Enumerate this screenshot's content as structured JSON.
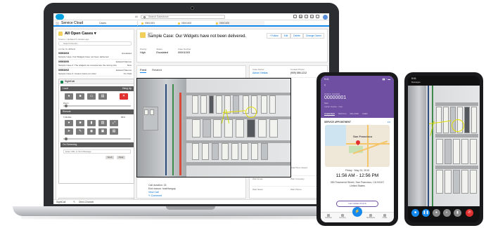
{
  "header": {
    "search_scope": "All",
    "search_placeholder": "Search Salesforce"
  },
  "app_nav": {
    "app_name": "Service Cloud",
    "object_select": "Cases",
    "tabs": [
      {
        "label": "00001001"
      },
      {
        "label": "00001002"
      },
      {
        "label": "00001000"
      }
    ]
  },
  "list_panel": {
    "title": "All Open Cases",
    "subtitle": "5 items • Updated 6 minutes ago",
    "search_placeholder": "Search this list...",
    "column_header": "CASE NUMBER",
    "rows": [
      {
        "number": "00001003",
        "subject": "Sample Case: Our Widgets have not been delivered",
        "owner": "Escalated",
        "status": "Escalated"
      },
      {
        "number": "00001000",
        "subject": "Sample Case 2: The widgets we received are the wrong size",
        "owner": "Edward Stamos",
        "status": "New"
      },
      {
        "number": "00001002",
        "subject": "Sample Case 3: Cannot track our order",
        "owner": "Edward Stamos",
        "status": "On Hold"
      }
    ]
  },
  "sightcall": {
    "title": "SightCall",
    "local_label": "Local",
    "hang_up": "Hang Up",
    "zoom_label": "Zoom",
    "remote_label": "Remote",
    "remote_device": "T-Mobile",
    "remote_battery": "89%",
    "screenshot_label": "On-Screening",
    "message_placeholder": "Enter URL or Text Message",
    "send_label": "Send",
    "clear_label": "Clear",
    "bottom_placeholder": "Send your text"
  },
  "footer": {
    "sightcall": "SightCall",
    "omni": "Omni-Channel"
  },
  "record": {
    "type_label": "Case",
    "title": "Sample Case: Our Widgets have not been delivered.",
    "actions": [
      "+ Follow",
      "Edit",
      "Delete",
      "Change Owner"
    ],
    "fields": [
      {
        "label": "Priority",
        "value": "High"
      },
      {
        "label": "Status",
        "value": "Escalated"
      },
      {
        "label": "Case Number",
        "value": "00001003"
      }
    ],
    "feed_tabs": [
      "Feed",
      "Related"
    ],
    "feed_lines": [
      "Call duration: 15",
      "End reason: hostHangup"
    ],
    "feed_link_text": "View Call",
    "comment_label": "Comment",
    "details": [
      {
        "label": "Case Owner",
        "value": "Adrian Viestas"
      },
      {
        "label": "Contact Phone",
        "value": "(909) 555-1212"
      },
      {
        "label": "Date/Time Opened",
        "value": "5/14/2019 4:36 PM"
      },
      {
        "label": "Date/Time Closed",
        "value": ""
      },
      {
        "label": "Web Email",
        "value": ""
      },
      {
        "label": "Web Company",
        "value": ""
      },
      {
        "label": "Web Name",
        "value": ""
      },
      {
        "label": "Web Phone",
        "value": ""
      }
    ]
  },
  "phone1": {
    "status_time": "9:41",
    "wo_label": "WORK ORDER",
    "wo_number": "00000001",
    "wo_sub": "Test",
    "wo_meta": "Adrian Viestas · New",
    "tabs": [
      "OVERVIEW",
      "DETAILS",
      "RELATED",
      "FEED"
    ],
    "appointment_label": "SERVICE APPOINTMENT",
    "map_city": "San Francisco",
    "date": "Friday · May 24, 2019",
    "time": "11:56 AM - 12:56 PM",
    "address": "350 Townsend Street, San Francisco, CA 94107 United States",
    "directions": "GET DIRECTIONS",
    "nav": [
      "Schedule",
      "Inventory",
      "Notifications",
      "Profile"
    ]
  },
  "phone2": {
    "status_time": "5:01",
    "status_sub": "Messages"
  }
}
